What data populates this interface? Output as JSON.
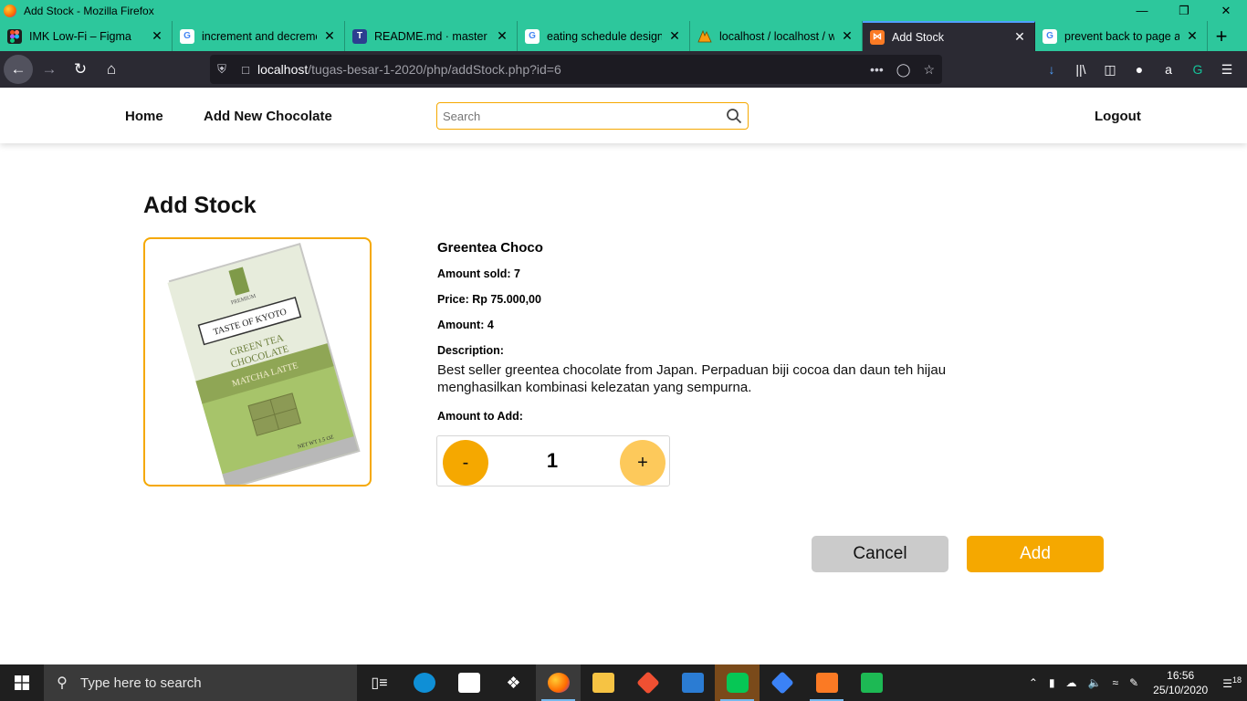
{
  "window": {
    "title": "Add Stock - Mozilla Firefox"
  },
  "tabs": [
    {
      "label": "IMK Low-Fi – Figma",
      "icon": "figma-icon",
      "color": "#f24e1e"
    },
    {
      "label": "increment and decrement",
      "icon": "google-icon",
      "color": "#ffffff"
    },
    {
      "label": "README.md · master · IF",
      "icon": "gitlab-icon",
      "color": "#2c3e90"
    },
    {
      "label": "eating schedule design",
      "icon": "google-icon",
      "color": "#ffffff"
    },
    {
      "label": "localhost / localhost / w",
      "icon": "phpmyadmin-icon",
      "color": "#f89c0e"
    },
    {
      "label": "Add Stock",
      "icon": "xampp-icon",
      "color": "#fb7a24"
    },
    {
      "label": "prevent back to page aft",
      "icon": "google-icon",
      "color": "#ffffff"
    }
  ],
  "urlbar": {
    "host": "localhost",
    "path": "/tugas-besar-1-2020/php/addStock.php?id=6"
  },
  "site": {
    "nav": {
      "home": "Home",
      "add_new": "Add New Chocolate",
      "logout": "Logout"
    },
    "search": {
      "placeholder": "Search"
    }
  },
  "page": {
    "title": "Add Stock",
    "product": {
      "name": "Greentea Choco",
      "amount_sold": "Amount sold: 7",
      "price": "Price: Rp 75.000,00",
      "amount": "Amount: 4",
      "description_label": "Description:",
      "description": "Best seller greentea chocolate from Japan. Perpaduan biji cocoa dan daun teh hijau menghasilkan kombinasi kelezatan yang sempurna.",
      "package_brand": "TASTE OF KYOTO",
      "package_line1": "GREEN TEA",
      "package_line2": "CHOCOLATE",
      "package_flavor": "MATCHA LATTE",
      "package_premium": "PREMIUM",
      "package_weight": "NET WT 1.5 OZ"
    },
    "amount_to_add_label": "Amount to Add:",
    "stepper": {
      "minus": "-",
      "value": "1",
      "plus": "+"
    },
    "buttons": {
      "cancel": "Cancel",
      "add": "Add"
    },
    "colors": {
      "accent": "#f5a800",
      "accent_light": "#fdc95b",
      "cancel": "#cbcbcb"
    }
  },
  "taskbar": {
    "search_placeholder": "Type here to search",
    "time": "16:56",
    "date": "25/10/2020",
    "notifications": "18"
  }
}
